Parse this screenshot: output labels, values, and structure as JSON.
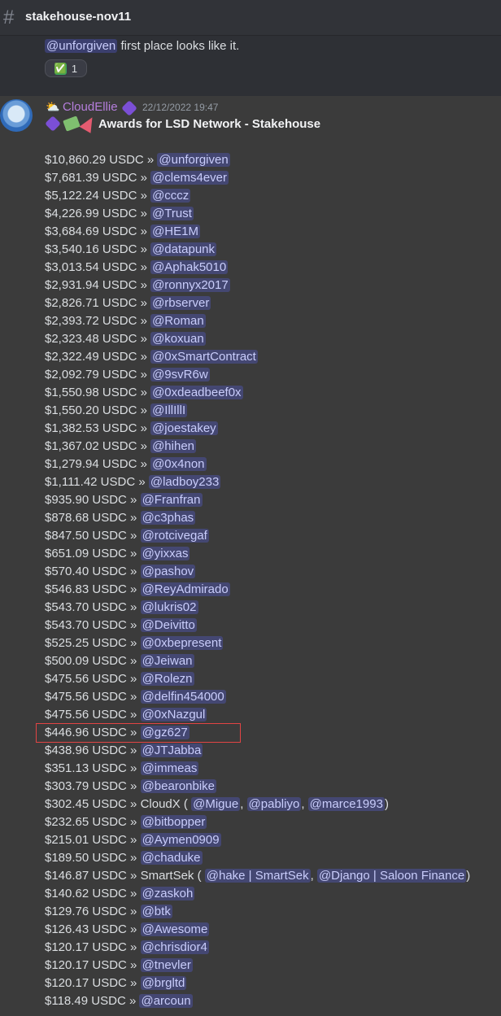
{
  "channel": {
    "name": "stakehouse-nov11"
  },
  "previous_message": {
    "mention": "@unforgiven",
    "text": " first place looks like it.",
    "reaction": {
      "emoji": "✅",
      "count": "1"
    }
  },
  "message": {
    "author": "CloudEllie",
    "timestamp": "22/12/2022 19:47",
    "award_title": "Awards for LSD Network - Stakehouse",
    "rows": [
      {
        "amount": "$10,860.29 USDC » ",
        "mention": "@unforgiven"
      },
      {
        "amount": "$7,681.39 USDC » ",
        "mention": "@clems4ever"
      },
      {
        "amount": "$5,122.24 USDC » ",
        "mention": "@cccz"
      },
      {
        "amount": "$4,226.99 USDC » ",
        "mention": "@Trust"
      },
      {
        "amount": "$3,684.69 USDC » ",
        "mention": "@HE1M"
      },
      {
        "amount": "$3,540.16 USDC » ",
        "mention": "@datapunk"
      },
      {
        "amount": "$3,013.54 USDC » ",
        "mention": "@Aphak5010"
      },
      {
        "amount": "$2,931.94 USDC » ",
        "mention": "@ronnyx2017"
      },
      {
        "amount": "$2,826.71 USDC » ",
        "mention": "@rbserver"
      },
      {
        "amount": "$2,393.72 USDC » ",
        "mention": "@Roman"
      },
      {
        "amount": "$2,323.48 USDC » ",
        "mention": "@koxuan"
      },
      {
        "amount": "$2,322.49 USDC » ",
        "mention": "@0xSmartContract"
      },
      {
        "amount": "$2,092.79 USDC » ",
        "mention": "@9svR6w"
      },
      {
        "amount": "$1,550.98 USDC » ",
        "mention": "@0xdeadbeef0x"
      },
      {
        "amount": "$1,550.20 USDC » ",
        "mention": "@IllIllI"
      },
      {
        "amount": "$1,382.53 USDC » ",
        "mention": "@joestakey"
      },
      {
        "amount": "$1,367.02 USDC » ",
        "mention": "@hihen"
      },
      {
        "amount": "$1,279.94 USDC » ",
        "mention": "@0x4non"
      },
      {
        "amount": "$1,111.42 USDC » ",
        "mention": "@ladboy233"
      },
      {
        "amount": "$935.90 USDC » ",
        "mention": "@Franfran"
      },
      {
        "amount": "$878.68 USDC » ",
        "mention": "@c3phas"
      },
      {
        "amount": "$847.50 USDC » ",
        "mention": "@rotcivegaf"
      },
      {
        "amount": "$651.09 USDC » ",
        "mention": "@yixxas"
      },
      {
        "amount": "$570.40 USDC » ",
        "mention": "@pashov"
      },
      {
        "amount": "$546.83 USDC » ",
        "mention": "@ReyAdmirado"
      },
      {
        "amount": "$543.70 USDC » ",
        "mention": "@lukris02"
      },
      {
        "amount": "$543.70 USDC » ",
        "mention": "@Deivitto"
      },
      {
        "amount": "$525.25 USDC » ",
        "mention": "@0xbepresent"
      },
      {
        "amount": "$500.09 USDC » ",
        "mention": "@Jeiwan"
      },
      {
        "amount": "$475.56 USDC » ",
        "mention": "@Rolezn"
      },
      {
        "amount": "$475.56 USDC » ",
        "mention": "@delfin454000"
      },
      {
        "amount": "$475.56 USDC » ",
        "mention": "@0xNazgul"
      },
      {
        "amount": "$446.96 USDC » ",
        "mention": "@gz627"
      },
      {
        "amount": "$438.96 USDC » ",
        "mention": "@JTJabba"
      },
      {
        "amount": "$351.13 USDC » ",
        "mention": "@immeas"
      },
      {
        "amount": "$303.79 USDC » ",
        "mention": "@bearonbike"
      },
      {
        "amount": "$302.45 USDC » CloudX (",
        "team": [
          "@Migue",
          "@pabliyo",
          "@marce1993"
        ]
      },
      {
        "amount": "$232.65 USDC » ",
        "mention": "@bitbopper"
      },
      {
        "amount": "$215.01 USDC » ",
        "mention": "@Aymen0909"
      },
      {
        "amount": "$189.50 USDC » ",
        "mention": "@chaduke"
      },
      {
        "amount": "$146.87 USDC » SmartSek (",
        "team": [
          "@hake | SmartSek",
          "@Django | Saloon Finance"
        ]
      },
      {
        "amount": "$140.62 USDC » ",
        "mention": "@zaskoh"
      },
      {
        "amount": "$129.76 USDC » ",
        "mention": "@btk"
      },
      {
        "amount": "$126.43 USDC » ",
        "mention": "@Awesome"
      },
      {
        "amount": "$120.17 USDC » ",
        "mention": "@chrisdior4"
      },
      {
        "amount": "$120.17 USDC » ",
        "mention": "@tnevler"
      },
      {
        "amount": "$120.17 USDC » ",
        "mention": "@brgltd"
      },
      {
        "amount": "$118.49 USDC » ",
        "mention": "@arcoun"
      }
    ]
  }
}
